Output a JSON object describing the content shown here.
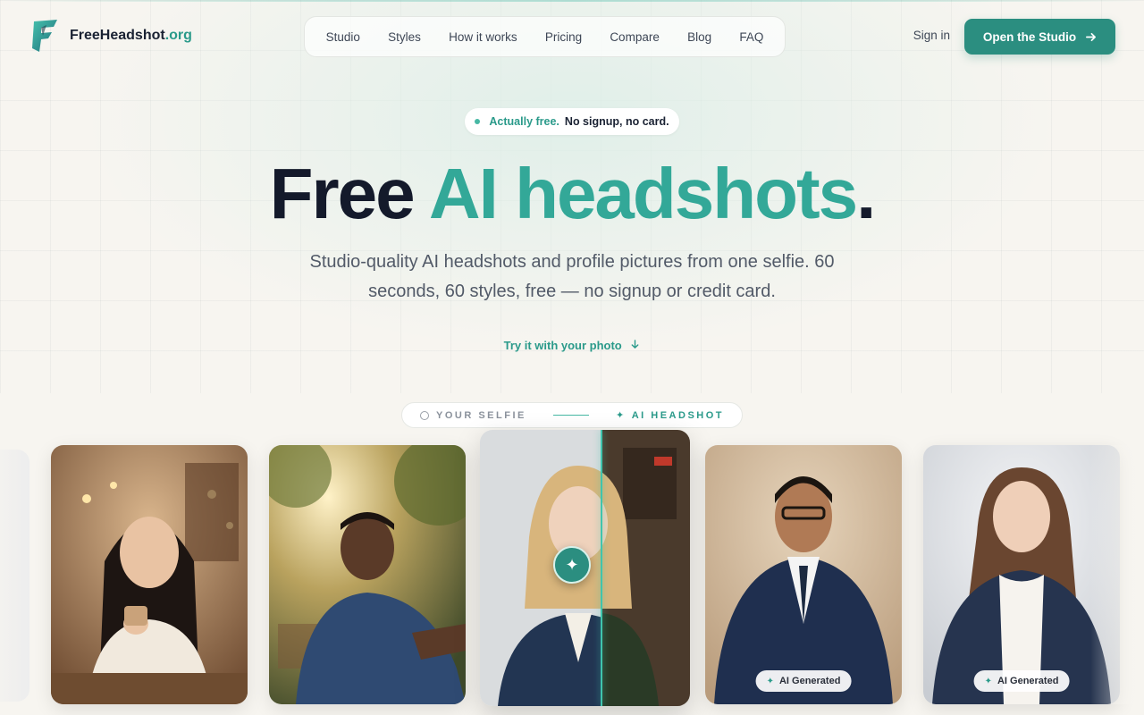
{
  "brand": {
    "name": "FreeHeadshot",
    "tld": ".org",
    "icon": "brand-logo-icon"
  },
  "nav": {
    "items": [
      "Studio",
      "Styles",
      "How it works",
      "Pricing",
      "Compare",
      "Blog",
      "FAQ"
    ]
  },
  "header": {
    "signin": "Sign in",
    "cta": "Open the Studio",
    "cta_icon": "arrow-right-icon"
  },
  "hero": {
    "pill_highlight": "Actually free.",
    "pill_rest": "No signup, no card.",
    "title_part1": "Free",
    "title_part2": "AI headshots",
    "title_part3": ".",
    "subtitle": "Studio-quality AI headshots and profile pictures from one selfie. 60 seconds, 60 styles, free — no signup or credit card.",
    "try_link": "Try it with your photo",
    "try_icon": "arrow-down-icon"
  },
  "toggle": {
    "left": "YOUR SELFIE",
    "right": "AI HEADSHOT"
  },
  "cards": {
    "badge": "AI Generated"
  },
  "colors": {
    "accent": "#2b8e80",
    "accent_light": "#33a898",
    "dark": "#141a2b",
    "bg": "#f7f5f0"
  }
}
